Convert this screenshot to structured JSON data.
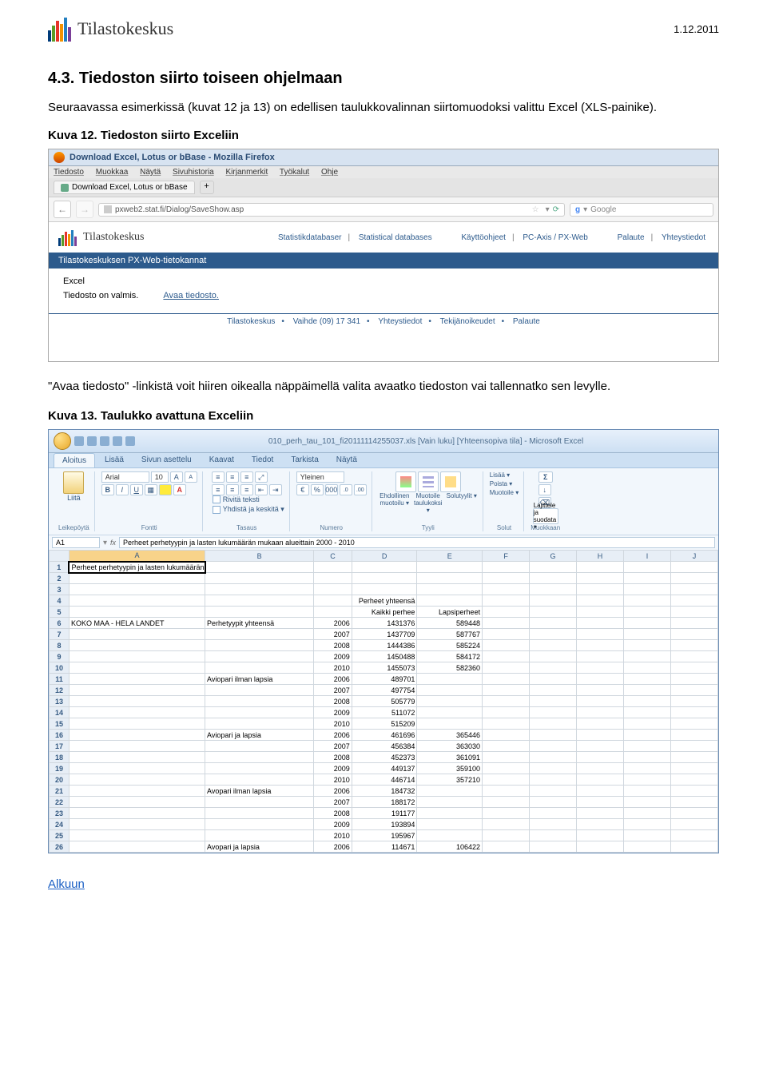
{
  "page_date": "1.12.2011",
  "logo_text": "Tilastokeskus",
  "section_title": "4.3. Tiedoston siirto toiseen ohjelmaan",
  "section_para": "Seuraavassa esimerkissä (kuvat 12 ja 13) on edellisen taulukkovalinnan siirtomuodoksi valittu Excel (XLS-painike).",
  "caption12": "Kuva 12. Tiedoston siirto Exceliin",
  "firefox": {
    "title": "Download Excel, Lotus or bBase - Mozilla Firefox",
    "menu": [
      "Tiedosto",
      "Muokkaa",
      "Näytä",
      "Sivuhistoria",
      "Kirjanmerkit",
      "Työkalut",
      "Ohje"
    ],
    "tab_label": "Download Excel, Lotus or bBase",
    "tab_plus": "+",
    "nav_back": "←",
    "nav_fwd": "→",
    "url": "pxweb2.stat.fi/Dialog/SaveShow.asp",
    "star": "☆",
    "reload": "⟳",
    "search_engine_icon": "g",
    "search_placeholder": "Google"
  },
  "site": {
    "top_links": [
      "Statistikdatabaser",
      "Statistical databases",
      "Käyttöohjeet",
      "PC-Axis / PX-Web",
      "Palaute",
      "Yhteystiedot"
    ],
    "bluebar": "Tilastokeskuksen PX-Web-tietokannat",
    "excel_label": "Excel",
    "ready_text": "Tiedosto on valmis.",
    "open_link": "Avaa tiedosto.",
    "footer": [
      "Tilastokeskus",
      "Vaihde (09) 17 341",
      "Yhteystiedot",
      "Tekijänoikeudet",
      "Palaute"
    ]
  },
  "quote_para": "\"Avaa tiedosto\" -linkistä voit hiiren oikealla näppäimellä valita avaatko tiedoston vai tallennatko sen levylle.",
  "caption13": "Kuva 13. Taulukko avattuna Exceliin",
  "excel": {
    "title": "010_perh_tau_101_fi20111114255037.xls  [Vain luku] [Yhteensopiva tila] - Microsoft Excel",
    "tabs": [
      "Aloitus",
      "Lisää",
      "Sivun asettelu",
      "Kaavat",
      "Tiedot",
      "Tarkista",
      "Näytä"
    ],
    "clipboard": {
      "paste": "Liitä",
      "group": "Leikepöytä"
    },
    "font": {
      "name": "Arial",
      "size": "10",
      "group": "Fontti",
      "bold": "B",
      "italic": "I",
      "underline": "U",
      "inc": "A",
      "dec": "A"
    },
    "align": {
      "wrap": "Rivitä teksti",
      "merge": "Yhdistä ja keskitä ▾",
      "group": "Tasaus"
    },
    "number": {
      "fmt": "Yleinen",
      "pct": "%",
      "comma": "000",
      "inc": ".0",
      "dec": ".00",
      "group": "Numero"
    },
    "styles": {
      "cond": "Ehdollinen muotoilu ▾",
      "table": "Muotoile taulukoksi ▾",
      "cell": "Solutyylit ▾",
      "group": "Tyyli"
    },
    "cells": {
      "ins": "Lisää ▾",
      "del": "Poista ▾",
      "fmt": "Muotoile ▾",
      "group": "Solut"
    },
    "editing": {
      "sort": "Lajittele ja suodata ▾",
      "group": "Muokkaan"
    },
    "namebox": "A1",
    "fx": "fx",
    "formula": "Perheet perhetyypin ja lasten lukumäärän mukaan alueittain 2000 - 2010",
    "cols": [
      "A",
      "B",
      "C",
      "D",
      "E",
      "F",
      "G",
      "H",
      "I",
      "J"
    ]
  },
  "chart_data": {
    "type": "table",
    "title": "Perheet perhetyypin ja lasten lukumäärän mukaan alueittain 2000 - 2010",
    "row4_d": "Perheet yhteensä",
    "row5_d": "Kaikki perhee",
    "row5_e": "Lapsiperheet",
    "region": "KOKO MAA - HELA LANDET",
    "types": [
      "Perhetyypit yhteensä",
      "Aviopari ilman lapsia",
      "Aviopari ja lapsia",
      "Avopari ilman lapsia",
      "Avopari ja lapsia"
    ],
    "rows": [
      {
        "type_idx": 0,
        "year": 2006,
        "d": 1431376,
        "e": 589448
      },
      {
        "type_idx": 0,
        "year": 2007,
        "d": 1437709,
        "e": 587767
      },
      {
        "type_idx": 0,
        "year": 2008,
        "d": 1444386,
        "e": 585224
      },
      {
        "type_idx": 0,
        "year": 2009,
        "d": 1450488,
        "e": 584172
      },
      {
        "type_idx": 0,
        "year": 2010,
        "d": 1455073,
        "e": 582360
      },
      {
        "type_idx": 1,
        "year": 2006,
        "d": 489701,
        "e": 0
      },
      {
        "type_idx": 1,
        "year": 2007,
        "d": 497754,
        "e": 0
      },
      {
        "type_idx": 1,
        "year": 2008,
        "d": 505779,
        "e": 0
      },
      {
        "type_idx": 1,
        "year": 2009,
        "d": 511072,
        "e": 0
      },
      {
        "type_idx": 1,
        "year": 2010,
        "d": 515209,
        "e": 0
      },
      {
        "type_idx": 2,
        "year": 2006,
        "d": 461696,
        "e": 365446
      },
      {
        "type_idx": 2,
        "year": 2007,
        "d": 456384,
        "e": 363030
      },
      {
        "type_idx": 2,
        "year": 2008,
        "d": 452373,
        "e": 361091
      },
      {
        "type_idx": 2,
        "year": 2009,
        "d": 449137,
        "e": 359100
      },
      {
        "type_idx": 2,
        "year": 2010,
        "d": 446714,
        "e": 357210
      },
      {
        "type_idx": 3,
        "year": 2006,
        "d": 184732,
        "e": 0
      },
      {
        "type_idx": 3,
        "year": 2007,
        "d": 188172,
        "e": 0
      },
      {
        "type_idx": 3,
        "year": 2008,
        "d": 191177,
        "e": 0
      },
      {
        "type_idx": 3,
        "year": 2009,
        "d": 193894,
        "e": 0
      },
      {
        "type_idx": 3,
        "year": 2010,
        "d": 195967,
        "e": 0
      },
      {
        "type_idx": 4,
        "year": 2006,
        "d": 114671,
        "e": 106422
      }
    ]
  },
  "alkuun": "Alkuun"
}
